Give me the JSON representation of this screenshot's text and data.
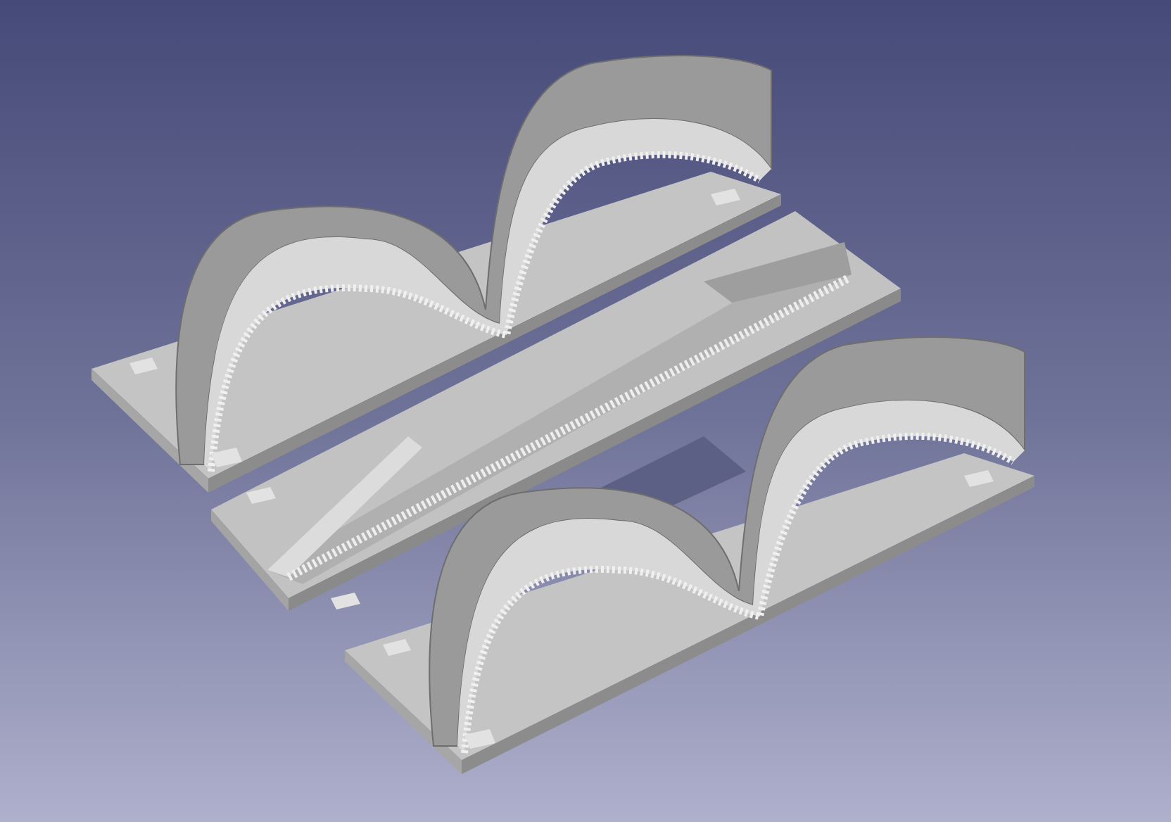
{
  "viewport": {
    "parts": [
      {
        "kind": "wave-plate"
      },
      {
        "kind": "ramp-plate"
      },
      {
        "kind": "wave-plate"
      }
    ]
  }
}
